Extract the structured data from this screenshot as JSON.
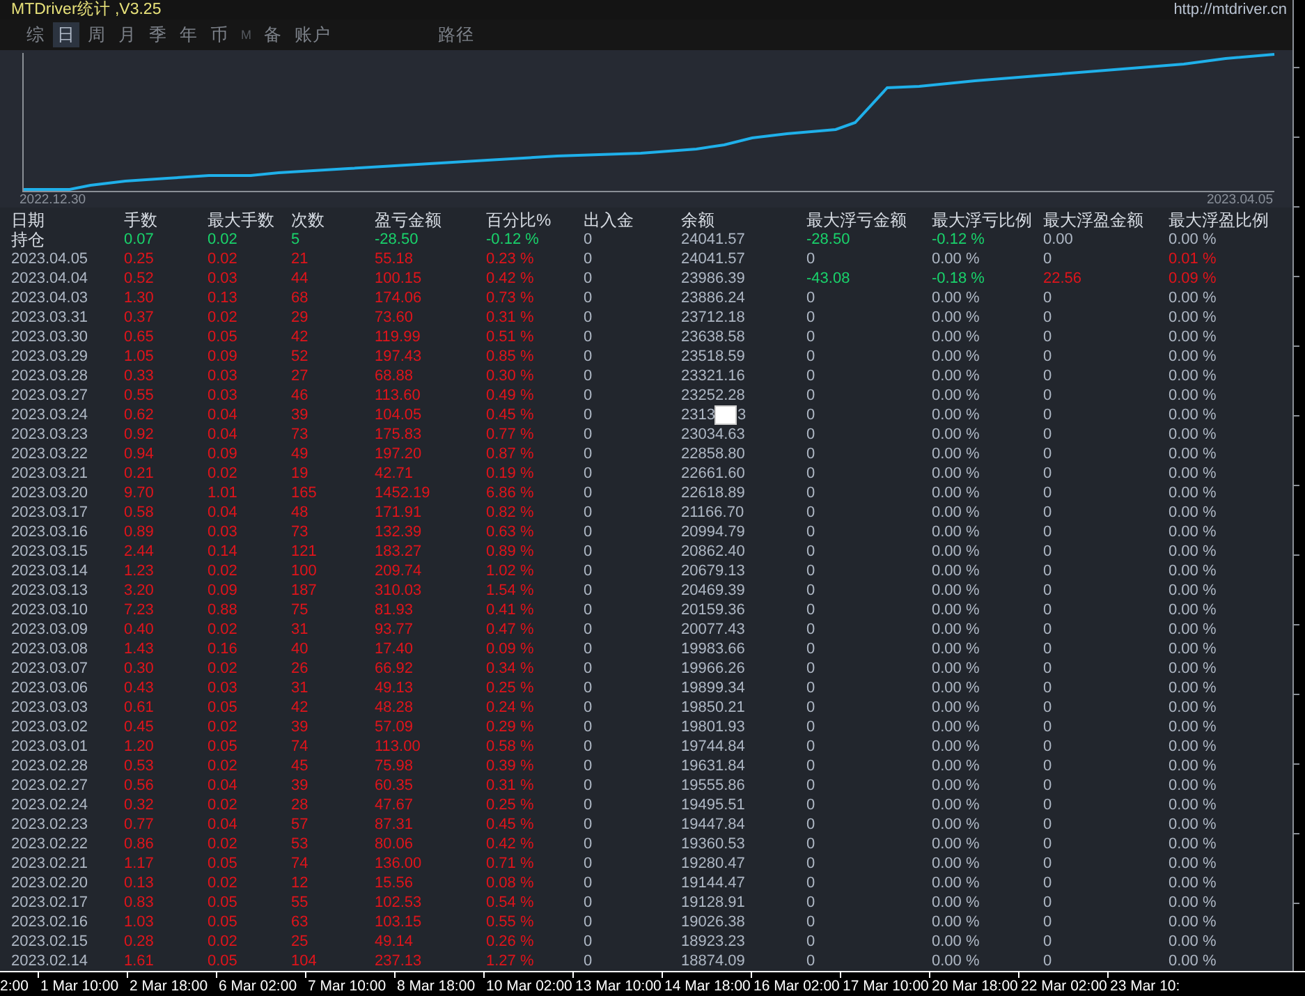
{
  "window": {
    "title": "MTDriver统计 ,V3.25",
    "url": "http://mtdriver.cn"
  },
  "tabs": [
    {
      "label": "综",
      "selected": false,
      "disabled": false
    },
    {
      "label": "日",
      "selected": true,
      "disabled": false
    },
    {
      "label": "周",
      "selected": false,
      "disabled": false
    },
    {
      "label": "月",
      "selected": false,
      "disabled": false
    },
    {
      "label": "季",
      "selected": false,
      "disabled": false
    },
    {
      "label": "年",
      "selected": false,
      "disabled": false
    },
    {
      "label": "币",
      "selected": false,
      "disabled": false
    },
    {
      "label": "M",
      "selected": false,
      "disabled": true
    },
    {
      "label": "备",
      "selected": false,
      "disabled": false
    },
    {
      "label": "账户",
      "selected": false,
      "disabled": false
    },
    {
      "label": "路径",
      "selected": false,
      "disabled": false
    }
  ],
  "chart": {
    "start_label": "2022.12.30",
    "end_label": "2023.04.05"
  },
  "table": {
    "columns": [
      "日期",
      "手数",
      "最大手数",
      "次数",
      "盈亏金额",
      "百分比%",
      "出入金",
      "余额",
      "最大浮亏金额",
      "最大浮亏比例",
      "最大浮盈金额",
      "最大浮盈比例"
    ],
    "rows": [
      {
        "cells": [
          "持仓",
          "0.07",
          "0.02",
          "5",
          "-28.50",
          "-0.12 %",
          "0",
          "24041.57",
          "-28.50",
          "-0.12 %",
          "0.00",
          "0.00 %"
        ],
        "gain": false,
        "float_highlighted": [
          true,
          true,
          false,
          false
        ]
      },
      {
        "cells": [
          "2023.04.05",
          "0.25",
          "0.02",
          "21",
          "55.18",
          "0.23 %",
          "0",
          "24041.57",
          "0",
          "0.00 %",
          "0",
          "0.01 %"
        ],
        "gain": true,
        "float_highlighted": [
          false,
          false,
          false,
          true
        ]
      },
      {
        "cells": [
          "2023.04.04",
          "0.52",
          "0.03",
          "44",
          "100.15",
          "0.42 %",
          "0",
          "23986.39",
          "-43.08",
          "-0.18 %",
          "22.56",
          "0.09 %"
        ],
        "gain": true,
        "float_highlighted": [
          true,
          true,
          true,
          true
        ]
      },
      {
        "cells": [
          "2023.04.03",
          "1.30",
          "0.13",
          "68",
          "174.06",
          "0.73 %",
          "0",
          "23886.24",
          "0",
          "0.00 %",
          "0",
          "0.00 %"
        ],
        "gain": true,
        "float_highlighted": [
          false,
          false,
          false,
          false
        ]
      },
      {
        "cells": [
          "2023.03.31",
          "0.37",
          "0.02",
          "29",
          "73.60",
          "0.31 %",
          "0",
          "23712.18",
          "0",
          "0.00 %",
          "0",
          "0.00 %"
        ],
        "gain": true,
        "float_highlighted": [
          false,
          false,
          false,
          false
        ]
      },
      {
        "cells": [
          "2023.03.30",
          "0.65",
          "0.05",
          "42",
          "119.99",
          "0.51 %",
          "0",
          "23638.58",
          "0",
          "0.00 %",
          "0",
          "0.00 %"
        ],
        "gain": true,
        "float_highlighted": [
          false,
          false,
          false,
          false
        ]
      },
      {
        "cells": [
          "2023.03.29",
          "1.05",
          "0.09",
          "52",
          "197.43",
          "0.85 %",
          "0",
          "23518.59",
          "0",
          "0.00 %",
          "0",
          "0.00 %"
        ],
        "gain": true,
        "float_highlighted": [
          false,
          false,
          false,
          false
        ]
      },
      {
        "cells": [
          "2023.03.28",
          "0.33",
          "0.03",
          "27",
          "68.88",
          "0.30 %",
          "0",
          "23321.16",
          "0",
          "0.00 %",
          "0",
          "0.00 %"
        ],
        "gain": true,
        "float_highlighted": [
          false,
          false,
          false,
          false
        ]
      },
      {
        "cells": [
          "2023.03.27",
          "0.55",
          "0.03",
          "46",
          "113.60",
          "0.49 %",
          "0",
          "23252.28",
          "0",
          "0.00 %",
          "0",
          "0.00 %"
        ],
        "gain": true,
        "float_highlighted": [
          false,
          false,
          false,
          false
        ]
      },
      {
        "cells": [
          "2023.03.24",
          "0.62",
          "0.04",
          "39",
          "104.05",
          "0.45 %",
          "0",
          "2313",
          "0",
          "0.00 %",
          "0",
          "0.00 %"
        ],
        "gain": true,
        "float_highlighted": [
          false,
          false,
          false,
          false
        ],
        "covered_tail": "3"
      },
      {
        "cells": [
          "2023.03.23",
          "0.92",
          "0.04",
          "73",
          "175.83",
          "0.77 %",
          "0",
          "23034.63",
          "0",
          "0.00 %",
          "0",
          "0.00 %"
        ],
        "gain": true,
        "float_highlighted": [
          false,
          false,
          false,
          false
        ]
      },
      {
        "cells": [
          "2023.03.22",
          "0.94",
          "0.09",
          "49",
          "197.20",
          "0.87 %",
          "0",
          "22858.80",
          "0",
          "0.00 %",
          "0",
          "0.00 %"
        ],
        "gain": true,
        "float_highlighted": [
          false,
          false,
          false,
          false
        ]
      },
      {
        "cells": [
          "2023.03.21",
          "0.21",
          "0.02",
          "19",
          "42.71",
          "0.19 %",
          "0",
          "22661.60",
          "0",
          "0.00 %",
          "0",
          "0.00 %"
        ],
        "gain": true,
        "float_highlighted": [
          false,
          false,
          false,
          false
        ]
      },
      {
        "cells": [
          "2023.03.20",
          "9.70",
          "1.01",
          "165",
          "1452.19",
          "6.86 %",
          "0",
          "22618.89",
          "0",
          "0.00 %",
          "0",
          "0.00 %"
        ],
        "gain": true,
        "float_highlighted": [
          false,
          false,
          false,
          false
        ]
      },
      {
        "cells": [
          "2023.03.17",
          "0.58",
          "0.04",
          "48",
          "171.91",
          "0.82 %",
          "0",
          "21166.70",
          "0",
          "0.00 %",
          "0",
          "0.00 %"
        ],
        "gain": true,
        "float_highlighted": [
          false,
          false,
          false,
          false
        ]
      },
      {
        "cells": [
          "2023.03.16",
          "0.89",
          "0.03",
          "73",
          "132.39",
          "0.63 %",
          "0",
          "20994.79",
          "0",
          "0.00 %",
          "0",
          "0.00 %"
        ],
        "gain": true,
        "float_highlighted": [
          false,
          false,
          false,
          false
        ]
      },
      {
        "cells": [
          "2023.03.15",
          "2.44",
          "0.14",
          "121",
          "183.27",
          "0.89 %",
          "0",
          "20862.40",
          "0",
          "0.00 %",
          "0",
          "0.00 %"
        ],
        "gain": true,
        "float_highlighted": [
          false,
          false,
          false,
          false
        ]
      },
      {
        "cells": [
          "2023.03.14",
          "1.23",
          "0.02",
          "100",
          "209.74",
          "1.02 %",
          "0",
          "20679.13",
          "0",
          "0.00 %",
          "0",
          "0.00 %"
        ],
        "gain": true,
        "float_highlighted": [
          false,
          false,
          false,
          false
        ]
      },
      {
        "cells": [
          "2023.03.13",
          "3.20",
          "0.09",
          "187",
          "310.03",
          "1.54 %",
          "0",
          "20469.39",
          "0",
          "0.00 %",
          "0",
          "0.00 %"
        ],
        "gain": true,
        "float_highlighted": [
          false,
          false,
          false,
          false
        ]
      },
      {
        "cells": [
          "2023.03.10",
          "7.23",
          "0.88",
          "75",
          "81.93",
          "0.41 %",
          "0",
          "20159.36",
          "0",
          "0.00 %",
          "0",
          "0.00 %"
        ],
        "gain": true,
        "float_highlighted": [
          false,
          false,
          false,
          false
        ]
      },
      {
        "cells": [
          "2023.03.09",
          "0.40",
          "0.02",
          "31",
          "93.77",
          "0.47 %",
          "0",
          "20077.43",
          "0",
          "0.00 %",
          "0",
          "0.00 %"
        ],
        "gain": true,
        "float_highlighted": [
          false,
          false,
          false,
          false
        ]
      },
      {
        "cells": [
          "2023.03.08",
          "1.43",
          "0.16",
          "40",
          "17.40",
          "0.09 %",
          "0",
          "19983.66",
          "0",
          "0.00 %",
          "0",
          "0.00 %"
        ],
        "gain": true,
        "float_highlighted": [
          false,
          false,
          false,
          false
        ]
      },
      {
        "cells": [
          "2023.03.07",
          "0.30",
          "0.02",
          "26",
          "66.92",
          "0.34 %",
          "0",
          "19966.26",
          "0",
          "0.00 %",
          "0",
          "0.00 %"
        ],
        "gain": true,
        "float_highlighted": [
          false,
          false,
          false,
          false
        ]
      },
      {
        "cells": [
          "2023.03.06",
          "0.43",
          "0.03",
          "31",
          "49.13",
          "0.25 %",
          "0",
          "19899.34",
          "0",
          "0.00 %",
          "0",
          "0.00 %"
        ],
        "gain": true,
        "float_highlighted": [
          false,
          false,
          false,
          false
        ]
      },
      {
        "cells": [
          "2023.03.03",
          "0.61",
          "0.05",
          "42",
          "48.28",
          "0.24 %",
          "0",
          "19850.21",
          "0",
          "0.00 %",
          "0",
          "0.00 %"
        ],
        "gain": true,
        "float_highlighted": [
          false,
          false,
          false,
          false
        ]
      },
      {
        "cells": [
          "2023.03.02",
          "0.45",
          "0.02",
          "39",
          "57.09",
          "0.29 %",
          "0",
          "19801.93",
          "0",
          "0.00 %",
          "0",
          "0.00 %"
        ],
        "gain": true,
        "float_highlighted": [
          false,
          false,
          false,
          false
        ]
      },
      {
        "cells": [
          "2023.03.01",
          "1.20",
          "0.05",
          "74",
          "113.00",
          "0.58 %",
          "0",
          "19744.84",
          "0",
          "0.00 %",
          "0",
          "0.00 %"
        ],
        "gain": true,
        "float_highlighted": [
          false,
          false,
          false,
          false
        ]
      },
      {
        "cells": [
          "2023.02.28",
          "0.53",
          "0.02",
          "45",
          "75.98",
          "0.39 %",
          "0",
          "19631.84",
          "0",
          "0.00 %",
          "0",
          "0.00 %"
        ],
        "gain": true,
        "float_highlighted": [
          false,
          false,
          false,
          false
        ]
      },
      {
        "cells": [
          "2023.02.27",
          "0.56",
          "0.04",
          "39",
          "60.35",
          "0.31 %",
          "0",
          "19555.86",
          "0",
          "0.00 %",
          "0",
          "0.00 %"
        ],
        "gain": true,
        "float_highlighted": [
          false,
          false,
          false,
          false
        ]
      },
      {
        "cells": [
          "2023.02.24",
          "0.32",
          "0.02",
          "28",
          "47.67",
          "0.25 %",
          "0",
          "19495.51",
          "0",
          "0.00 %",
          "0",
          "0.00 %"
        ],
        "gain": true,
        "float_highlighted": [
          false,
          false,
          false,
          false
        ]
      },
      {
        "cells": [
          "2023.02.23",
          "0.77",
          "0.04",
          "57",
          "87.31",
          "0.45 %",
          "0",
          "19447.84",
          "0",
          "0.00 %",
          "0",
          "0.00 %"
        ],
        "gain": true,
        "float_highlighted": [
          false,
          false,
          false,
          false
        ]
      },
      {
        "cells": [
          "2023.02.22",
          "0.86",
          "0.02",
          "53",
          "80.06",
          "0.42 %",
          "0",
          "19360.53",
          "0",
          "0.00 %",
          "0",
          "0.00 %"
        ],
        "gain": true,
        "float_highlighted": [
          false,
          false,
          false,
          false
        ]
      },
      {
        "cells": [
          "2023.02.21",
          "1.17",
          "0.05",
          "74",
          "136.00",
          "0.71 %",
          "0",
          "19280.47",
          "0",
          "0.00 %",
          "0",
          "0.00 %"
        ],
        "gain": true,
        "float_highlighted": [
          false,
          false,
          false,
          false
        ]
      },
      {
        "cells": [
          "2023.02.20",
          "0.13",
          "0.02",
          "12",
          "15.56",
          "0.08 %",
          "0",
          "19144.47",
          "0",
          "0.00 %",
          "0",
          "0.00 %"
        ],
        "gain": true,
        "float_highlighted": [
          false,
          false,
          false,
          false
        ]
      },
      {
        "cells": [
          "2023.02.17",
          "0.83",
          "0.05",
          "55",
          "102.53",
          "0.54 %",
          "0",
          "19128.91",
          "0",
          "0.00 %",
          "0",
          "0.00 %"
        ],
        "gain": true,
        "float_highlighted": [
          false,
          false,
          false,
          false
        ]
      },
      {
        "cells": [
          "2023.02.16",
          "1.03",
          "0.05",
          "63",
          "103.15",
          "0.55 %",
          "0",
          "19026.38",
          "0",
          "0.00 %",
          "0",
          "0.00 %"
        ],
        "gain": true,
        "float_highlighted": [
          false,
          false,
          false,
          false
        ]
      },
      {
        "cells": [
          "2023.02.15",
          "0.28",
          "0.02",
          "25",
          "49.14",
          "0.26 %",
          "0",
          "18923.23",
          "0",
          "0.00 %",
          "0",
          "0.00 %"
        ],
        "gain": true,
        "float_highlighted": [
          false,
          false,
          false,
          false
        ]
      },
      {
        "cells": [
          "2023.02.14",
          "1.61",
          "0.05",
          "104",
          "237.13",
          "1.27 %",
          "0",
          "18874.09",
          "0",
          "0.00 %",
          "0",
          "0.00 %"
        ],
        "gain": true,
        "float_highlighted": [
          false,
          false,
          false,
          false
        ]
      }
    ]
  },
  "time_axis": [
    "2:00",
    "1 Mar 10:00",
    "2 Mar 18:00",
    "6 Mar 02:00",
    "7 Mar 10:00",
    "8 Mar 18:00",
    "10 Mar 02:00",
    "13 Mar 10:00",
    "14 Mar 18:00",
    "16 Mar 02:00",
    "17 Mar 10:00",
    "20 Mar 18:00",
    "22 Mar 02:00",
    "23 Mar 10:"
  ]
}
